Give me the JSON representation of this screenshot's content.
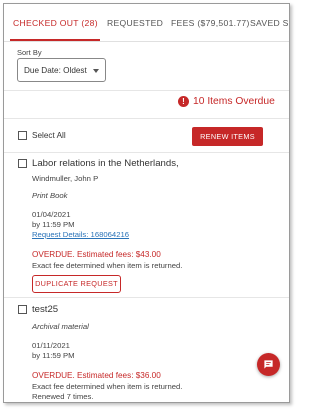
{
  "tabs": [
    {
      "label": "CHECKED OUT (28)",
      "active": true
    },
    {
      "label": "REQUESTED",
      "active": false
    },
    {
      "label": "FEES ($79,501.77)",
      "active": false
    },
    {
      "label": "SAVED SE",
      "active": false
    }
  ],
  "sort": {
    "label": "Sort By",
    "value": "Due Date: Oldest"
  },
  "overdue": {
    "icon": "alert-circle-icon",
    "text": "10 Items Overdue"
  },
  "select_all": {
    "label": "Select All",
    "renew_label": "RENEW ITEMS"
  },
  "items": [
    {
      "title": "Labor relations in the Netherlands,",
      "author": "Windmuller, John P",
      "format": "Print Book",
      "due_date": "01/04/2021",
      "due_time": "by 11:59 PM",
      "request_details": "Request Details: 168064216",
      "fee_line": "OVERDUE. Estimated fees: $43.00",
      "fee_note": "Exact fee determined when item is returned.",
      "button": "DUPLICATE REQUEST"
    },
    {
      "title": "test25",
      "format": "Archival material",
      "due_date": "01/11/2021",
      "due_time": "by 11:59 PM",
      "fee_line": "OVERDUE. Estimated fees: $36.00",
      "fee_note": "Exact fee determined when item is returned.",
      "renewed": "Renewed 7 times."
    }
  ],
  "colors": {
    "accent": "#c62828",
    "link": "#2a73b8"
  }
}
